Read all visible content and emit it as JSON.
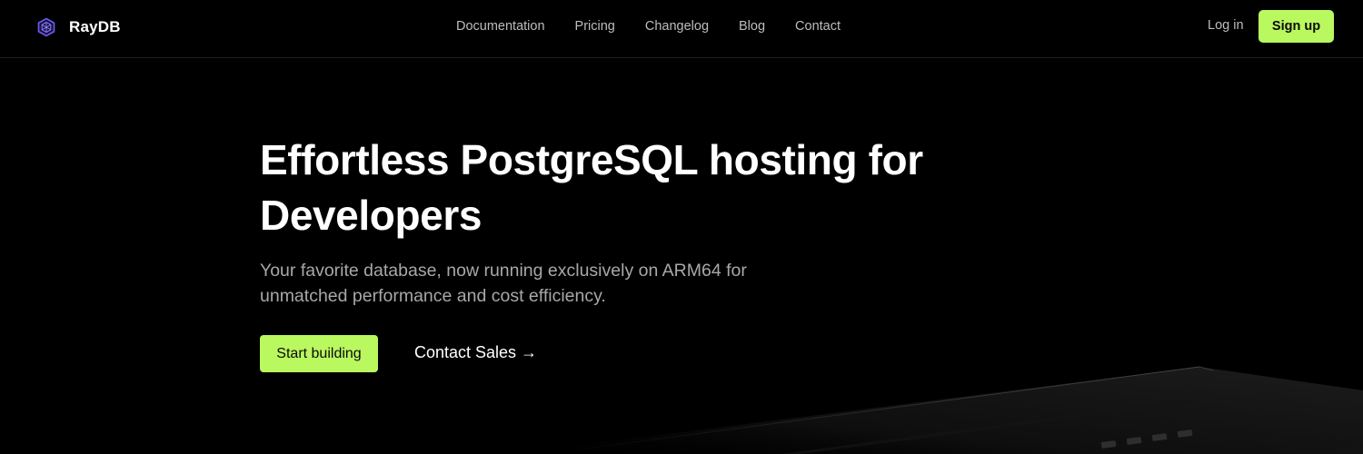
{
  "brand": {
    "name": "RayDB",
    "logo_icon": "hexagon-logo-icon",
    "logo_color": "#6b5cf6"
  },
  "nav": {
    "links": [
      "Documentation",
      "Pricing",
      "Changelog",
      "Blog",
      "Contact"
    ],
    "login": "Log in",
    "signup": "Sign up"
  },
  "hero": {
    "title": "Effortless PostgreSQL hosting for Developers",
    "subtitle": "Your favorite database, now running exclusively on ARM64 for unmatched performance and cost efficiency.",
    "primary_cta": "Start building",
    "secondary_cta": "Contact Sales →"
  },
  "colors": {
    "background": "#000000",
    "accent": "#b9f85f",
    "nav_text": "#bdbdbd",
    "subtitle_text": "#a8a8a8"
  }
}
